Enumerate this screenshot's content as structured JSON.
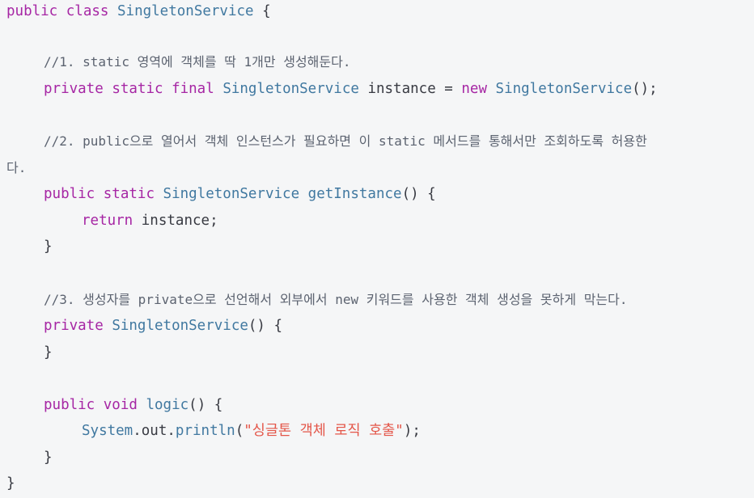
{
  "code": {
    "l1": {
      "kw1": "public",
      "kw2": "class",
      "name": "SingletonService",
      "brace": "{"
    },
    "c1": "//1. static 영역에 객체를 딱 1개만 생성해둔다.",
    "l2": {
      "kw1": "private",
      "kw2": "static",
      "kw3": "final",
      "type": "SingletonService",
      "var": "instance",
      "eq": "=",
      "kw4": "new",
      "ctor": "SingletonService",
      "tail": "();"
    },
    "c2a": "//2. public으로 열어서 객체 인스턴스가 필요하면 이 static 메서드를 통해서만 조회하도록 허용한",
    "c2b": "다.",
    "l3": {
      "kw1": "public",
      "kw2": "static",
      "type": "SingletonService",
      "method": "getInstance",
      "tail": "() {"
    },
    "l4": {
      "kw": "return",
      "var": "instance",
      "tail": ";"
    },
    "close1": "}",
    "c3": "//3. 생성자를 private으로 선언해서 외부에서 new 키워드를 사용한 객체 생성을 못하게 막는다.",
    "l5": {
      "kw": "private",
      "ctor": "SingletonService",
      "tail": "() {"
    },
    "close2": "}",
    "l6": {
      "kw1": "public",
      "kw2": "void",
      "method": "logic",
      "tail": "() {"
    },
    "l7": {
      "obj": "System",
      "dot1": ".",
      "field": "out",
      "dot2": ".",
      "method": "println",
      "open": "(",
      "str": "\"싱글톤 객체 로직 호출\"",
      "tail": ");"
    },
    "close3": "}",
    "close4": "}"
  },
  "colors": {
    "background": "#f5f6f7",
    "keyword": "#a626a4",
    "type": "#4078a0",
    "comment": "#5c6370",
    "string": "#e45649",
    "plain": "#383a42"
  }
}
